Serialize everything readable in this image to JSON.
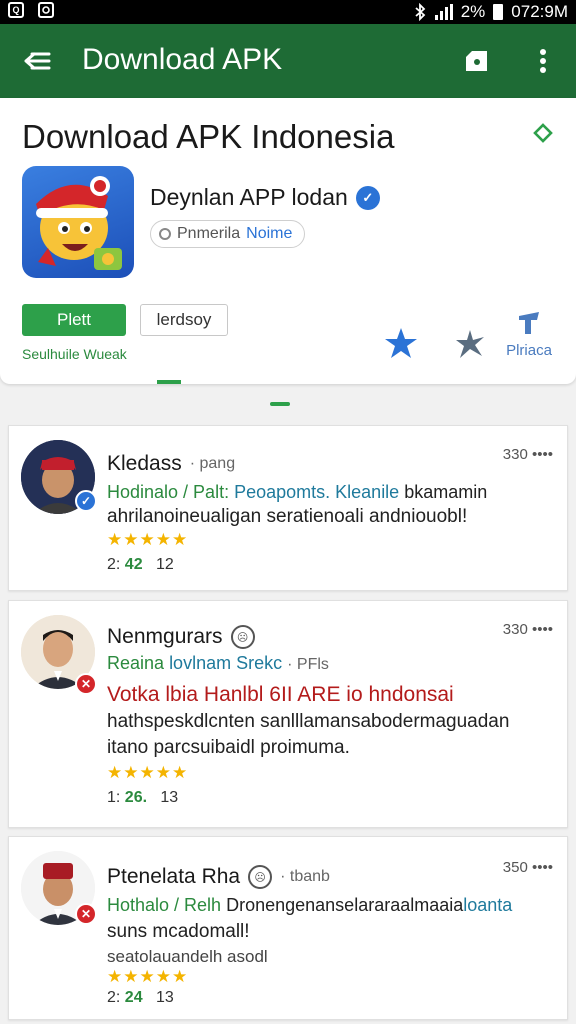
{
  "status_bar": {
    "battery_text": "2%",
    "time": "072:9M",
    "left_icon_1": "Q"
  },
  "app_bar": {
    "title": "Download APK",
    "icons": [
      "back-arrow-icon",
      "store-icon",
      "more-vert-icon"
    ]
  },
  "header": {
    "title": "Download APK Indonesia",
    "app_name": "Deynlan APP lodan",
    "category_prefix": "Pnmerila",
    "category_accent": "Noime",
    "primary_button": "Plett",
    "secondary_button": "lerdsoy",
    "link_text": "Seulhuile Wueak",
    "review_label": "Plriaca"
  },
  "reviews": [
    {
      "name": "Kledass",
      "meta": "· pang",
      "time": "330 ••••",
      "subtitle_green": "Hodinalo / Palt:",
      "subtitle_blue": "Peoapomts. Kleanile",
      "subtitle_rest": "bkamamin",
      "text_lines": [
        "ahrilanoineualigan seratienoali andniouobl!"
      ],
      "stars": "★★★★★",
      "stat_a": "2:",
      "stat_b": "42",
      "stat_c": "12"
    },
    {
      "name": "Nenmgurars",
      "meta": "",
      "time": "330 ••••",
      "subtitle_green": "Reaina",
      "subtitle_blue": "lovlnam Srekc",
      "subtitle_rest": "· PFls",
      "highlight": "Votka lbia Hanlbl 6II ARE io hndonsai",
      "text_lines": [
        "hathspeskdlcnten sanlllamansabodermaguadan",
        "itano parcsuibaidl proimuma."
      ],
      "stars": "★★★★★",
      "stat_a": "1:",
      "stat_b": "26.",
      "stat_c": "13"
    },
    {
      "name": "Ptenelata Rha",
      "meta": "· tbanb",
      "time": "350 ••••",
      "subtitle_green": "Hothalo / Relh",
      "subtitle_mid": "Dronengenanselararaalmaaia",
      "subtitle_blue": "loanta",
      "text_lines": [
        "suns mcadomall!",
        "seatolauandelh asodl"
      ],
      "stars": "★★★★★",
      "stat_a": "2:",
      "stat_b": "24",
      "stat_c": "13"
    }
  ],
  "colors": {
    "app_bar": "#1e6b35",
    "primary_green": "#2da04a",
    "link_green": "#2b8a3e",
    "accent_blue": "#2b73d6",
    "highlight_red": "#b31b1b",
    "star": "#f4b400"
  }
}
